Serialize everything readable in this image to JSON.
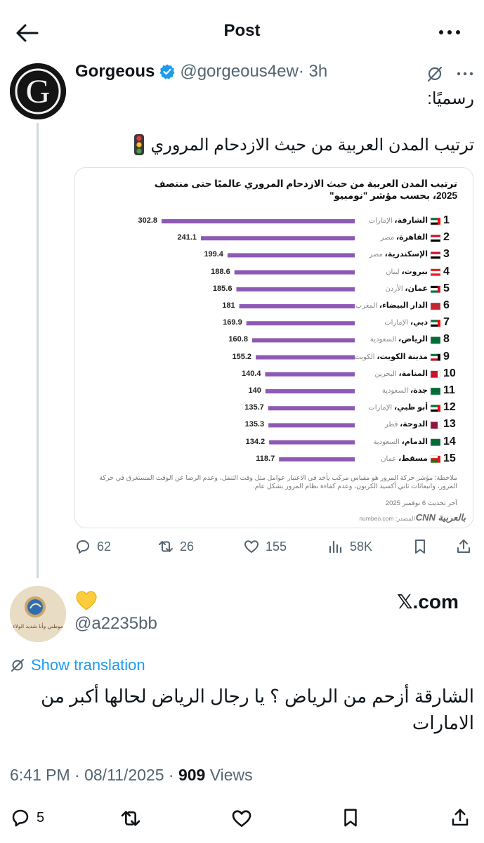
{
  "header": {
    "title": "Post"
  },
  "tweet": {
    "author_name": "Gorgeous",
    "handle": "@gorgeous4ew",
    "time": "· 3h",
    "line1": "رسميًا:",
    "line2": "ترتيب المدن العربية من حيث الازدحام المروري",
    "avatar_letter": "G",
    "icons": [
      "back-arrow-icon",
      "more-icon",
      "verified-badge-icon",
      "grok-icon",
      "traffic-light-icon"
    ]
  },
  "card": {
    "title": "ترتيب المدن العربية من حيث الازدحام المروري عالميًا حتى منتصف 2025، بحسب مؤشر \"نومبيو\"",
    "note": "ملاحظة: مؤشر حركة المرور هو مقياس مركب يأخذ في الاعتبار عوامل مثل وقت التنقل، وعدم الرضا عن الوقت المستغرق في حركة المرور، وانبعاثات ثاني أكسيد الكربون، وعدم كفاءة نظام المرور بشكل عام.",
    "updated": "آخر تحديث 6 نوفمبر 2025",
    "source": "المصدر: numbeo.com",
    "logo": "CNN بالعربية"
  },
  "chart_data": {
    "type": "bar",
    "title": "ترتيب المدن العربية من حيث الازدحام المروري عالميًا حتى منتصف 2025، بحسب مؤشر \"نومبيو\"",
    "bar_color": "#8e59b5",
    "rows": [
      {
        "rank": "1",
        "city": "الشارقة،",
        "country": "الإمارات",
        "value": 302.8,
        "flag": "uae"
      },
      {
        "rank": "2",
        "city": "القاهرة،",
        "country": "مصر",
        "value": 241.1,
        "flag": "egypt"
      },
      {
        "rank": "3",
        "city": "الإسكندرية،",
        "country": "مصر",
        "value": 199.4,
        "flag": "egypt"
      },
      {
        "rank": "4",
        "city": "بيروت،",
        "country": "لبنان",
        "value": 188.6,
        "flag": "lebanon"
      },
      {
        "rank": "5",
        "city": "عمان،",
        "country": "الأردن",
        "value": 185.6,
        "flag": "jordan"
      },
      {
        "rank": "6",
        "city": "الدار البيضاء،",
        "country": "المغرب",
        "value": 181,
        "flag": "morocco"
      },
      {
        "rank": "7",
        "city": "دبي،",
        "country": "الإمارات",
        "value": 169.9,
        "flag": "uae"
      },
      {
        "rank": "8",
        "city": "الرياض،",
        "country": "السعودية",
        "value": 160.8,
        "flag": "saudi"
      },
      {
        "rank": "9",
        "city": "مدينة الكويت،",
        "country": "الكويت",
        "value": 155.2,
        "flag": "kuwait"
      },
      {
        "rank": "10",
        "city": "المنامة،",
        "country": "البحرين",
        "value": 140.4,
        "flag": "bahrain"
      },
      {
        "rank": "11",
        "city": "جدة،",
        "country": "السعودية",
        "value": 140,
        "flag": "saudi"
      },
      {
        "rank": "12",
        "city": "أبو ظبي،",
        "country": "الإمارات",
        "value": 135.7,
        "flag": "uae"
      },
      {
        "rank": "13",
        "city": "الدوحة،",
        "country": "قطر",
        "value": 135.3,
        "flag": "qatar"
      },
      {
        "rank": "14",
        "city": "الدمام،",
        "country": "السعودية",
        "value": 134.2,
        "flag": "saudi"
      },
      {
        "rank": "15",
        "city": "مسقط،",
        "country": "عمان",
        "value": 118.7,
        "flag": "oman"
      }
    ]
  },
  "actions": {
    "replies": "62",
    "reposts": "26",
    "likes": "155",
    "views": "58K"
  },
  "reply": {
    "avatar_text": "موطني وأنا شديد الولاء",
    "handle": "@a2235bb",
    "xcom": "𝕏.com",
    "show_translation": "Show translation",
    "text": "الشارقة أزحم من الرياض ؟ يا رجال الرياض لحالها أكبر من الامارات"
  },
  "footer": {
    "timestamp": "6:41 PM · 08/11/2025 · ",
    "views_count": "909",
    "views_label": " Views",
    "reply_count": "5"
  }
}
